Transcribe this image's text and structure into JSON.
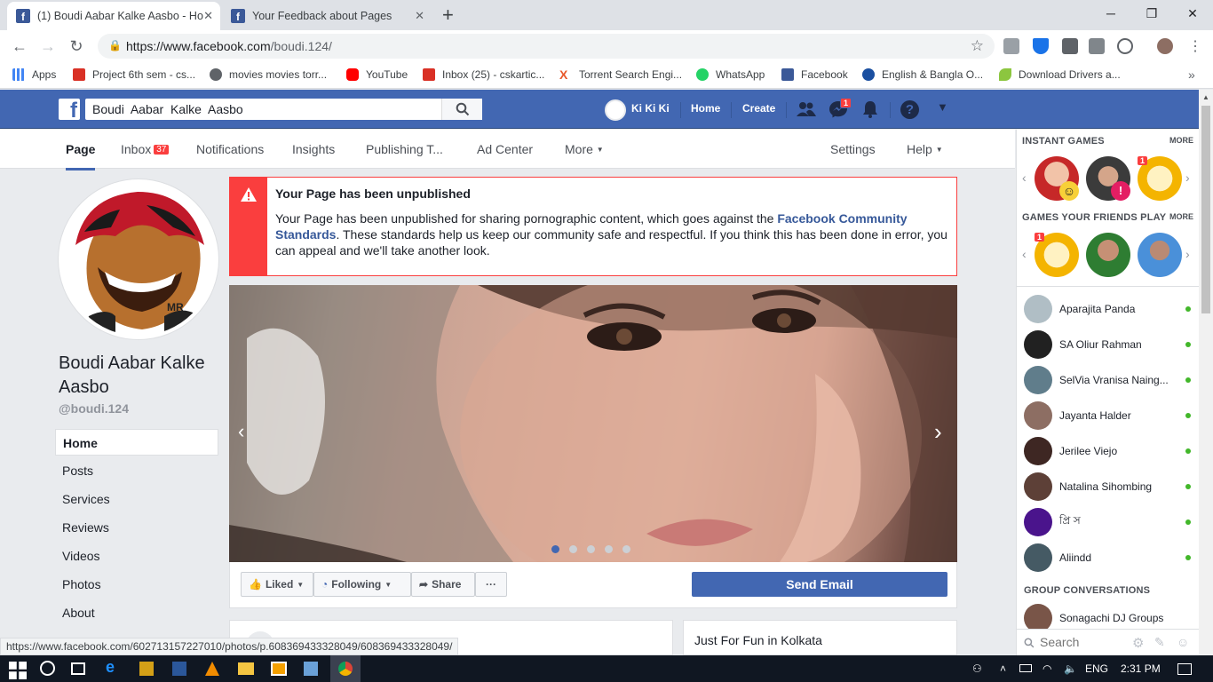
{
  "browser": {
    "tabs": [
      {
        "title": "(1) Boudi Aabar Kalke Aasbo - Ho"
      },
      {
        "title": "Your Feedback about Pages"
      }
    ],
    "url_host": "https://www.facebook.com",
    "url_path": "/boudi.124/",
    "bookmarks": [
      {
        "label": "Apps",
        "color": "#888888"
      },
      {
        "label": "Project 6th sem - cs...",
        "color": "#d93025"
      },
      {
        "label": "movies movies torr...",
        "color": "#5f6368"
      },
      {
        "label": "YouTube",
        "color": "#ff0000"
      },
      {
        "label": "Inbox (25) - cskartic...",
        "color": "#d93025"
      },
      {
        "label": "Torrent Search Engi...",
        "color": "#e8582b"
      },
      {
        "label": "WhatsApp",
        "color": "#25d366"
      },
      {
        "label": "Facebook",
        "color": "#3b5998"
      },
      {
        "label": "English & Bangla O...",
        "color": "#1a4fa0"
      },
      {
        "label": "Download Drivers a...",
        "color": "#8cc63f"
      }
    ],
    "status_url": "https://www.facebook.com/602713157227010/photos/p.608369433328049/608369433328049/"
  },
  "fbbar": {
    "search_value": "Boudi  Aabar  Kalke  Aasbo",
    "profile_name": "Ki Ki Ki",
    "home": "Home",
    "create": "Create",
    "messenger_badge": "1"
  },
  "pagenav": {
    "page": "Page",
    "inbox": "Inbox",
    "inbox_count": "37",
    "notifications": "Notifications",
    "insights": "Insights",
    "publishing": "Publishing T...",
    "adcenter": "Ad Center",
    "more": "More",
    "settings": "Settings",
    "help": "Help"
  },
  "page": {
    "name": "Boudi Aabar Kalke Aasbo",
    "handle": "@boudi.124",
    "avatar_tag": "MR",
    "left_nav": [
      "Home",
      "Posts",
      "Services",
      "Reviews",
      "Videos",
      "Photos",
      "About"
    ]
  },
  "warning": {
    "title": "Your Page has been unpublished",
    "body_start": "Your Page has been unpublished for sharing pornographic content, which goes against the ",
    "link": "Facebook Community Standards",
    "body_end": ". These standards help us keep our community safe and respectful. If you think this has been done in error, you can appeal and we'll take another look."
  },
  "actions": {
    "liked": "Liked",
    "following": "Following",
    "share": "Share",
    "more": "···",
    "send_email": "Send Email"
  },
  "cards": {
    "right_title": "Just For Fun in Kolkata"
  },
  "sidebar": {
    "instant_games": "INSTANT GAMES",
    "more": "MORE",
    "friends_play": "GAMES YOUR FRIENDS PLAY",
    "game_badge": "1",
    "contacts": [
      {
        "name": "Aparajita Panda"
      },
      {
        "name": "SA Oliur Rahman"
      },
      {
        "name": "SelVia Vranisa Naing..."
      },
      {
        "name": "Jayanta Halder"
      },
      {
        "name": "Jerilee Viejo"
      },
      {
        "name": "Natalina Sihombing"
      },
      {
        "name": "প্রি স"
      },
      {
        "name": "Aliindd"
      }
    ],
    "group_conversations": "GROUP CONVERSATIONS",
    "group_name": "Sonagachi DJ Groups",
    "search_placeholder": "Search"
  },
  "taskbar": {
    "lang": "ENG",
    "time": "2:31 PM"
  }
}
